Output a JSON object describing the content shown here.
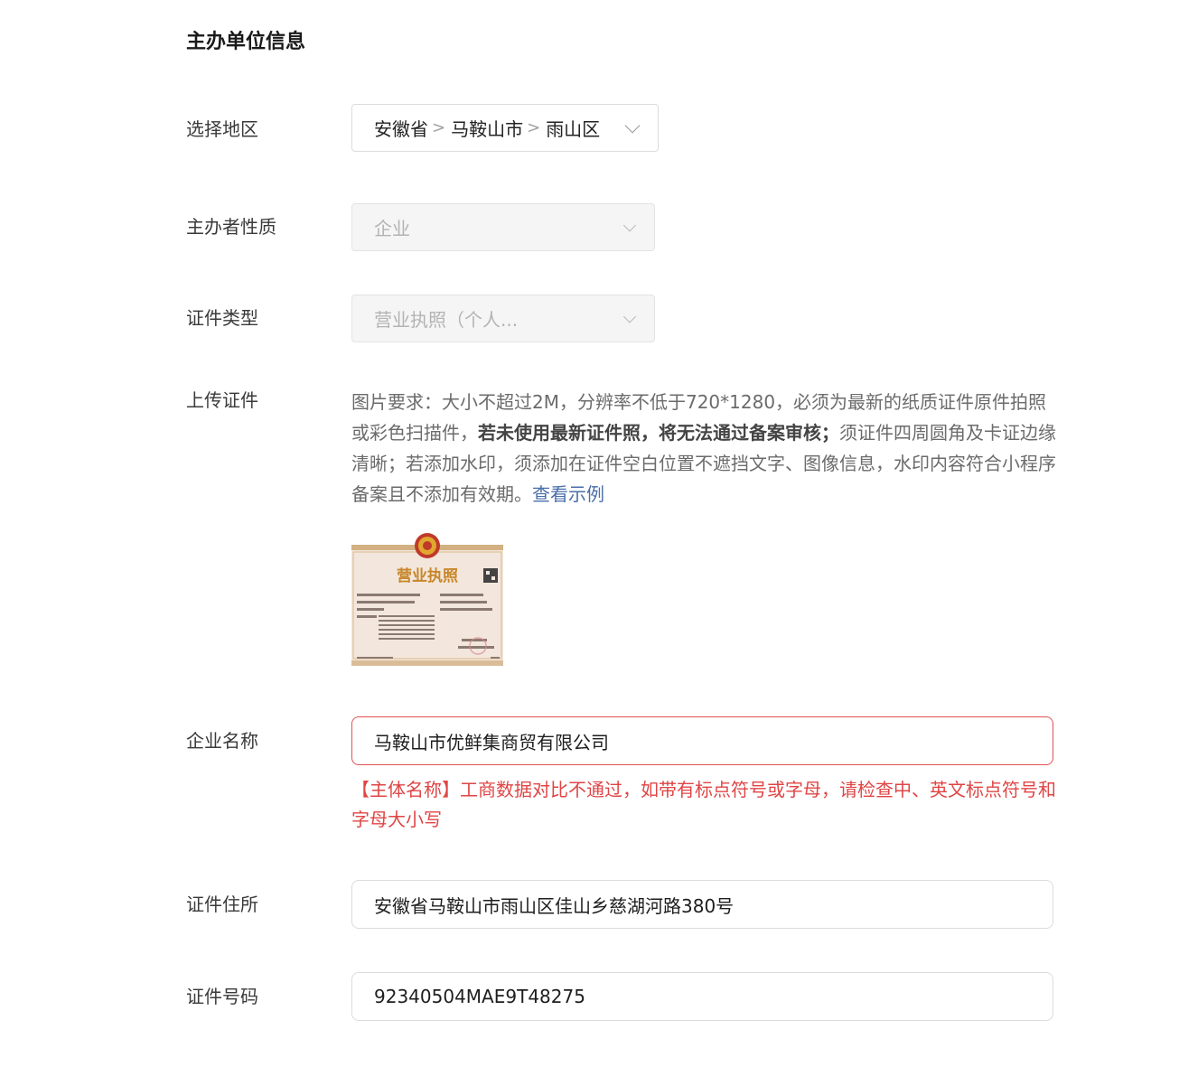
{
  "section_title": "主办单位信息",
  "region": {
    "label": "选择地区",
    "province": "安徽省",
    "city": "马鞍山市",
    "district": "雨山区",
    "separator": ">"
  },
  "nature": {
    "label": "主办者性质",
    "value": "企业"
  },
  "cert_type": {
    "label": "证件类型",
    "value": "营业执照（个人..."
  },
  "upload": {
    "label": "上传证件",
    "desc_part1": "图片要求：大小不超过2M，分辨率不低于720*1280，必须为最新的纸质证件原件拍照或彩色扫描件，",
    "desc_bold": "若未使用最新证件照，将无法通过备案审核；",
    "desc_part2": "须证件四周圆角及卡证边缘清晰；若添加水印，须添加在证件空白位置不遮挡文字、图像信息，水印内容符合小程序备案且不添加有效期。",
    "example_link": "查看示例",
    "license_title": "营业执照"
  },
  "company_name": {
    "label": "企业名称",
    "value": "马鞍山市优鲜集商贸有限公司",
    "error": "【主体名称】工商数据对比不通过，如带有标点符号或字母，请检查中、英文标点符号和字母大小写"
  },
  "address": {
    "label": "证件住所",
    "value": "安徽省马鞍山市雨山区佳山乡慈湖河路380号"
  },
  "cert_number": {
    "label": "证件号码",
    "value": "92340504MAE9T48275"
  },
  "colors": {
    "error": "#e04545",
    "link": "#4a6ea9",
    "disabled_bg": "#f4f5f4"
  }
}
